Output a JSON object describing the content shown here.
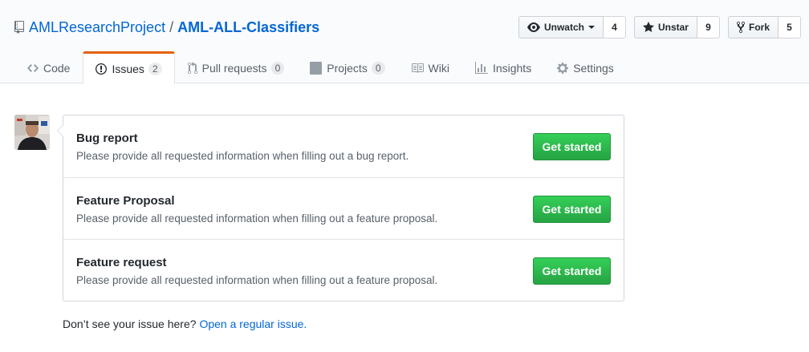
{
  "repo": {
    "owner": "AMLResearchProject",
    "separator": "/",
    "name": "AML-ALL-Classifiers"
  },
  "actions": {
    "watch": {
      "label": "Unwatch",
      "count": "4"
    },
    "star": {
      "label": "Unstar",
      "count": "9"
    },
    "fork": {
      "label": "Fork",
      "count": "5"
    }
  },
  "tabs": [
    {
      "label": "Code",
      "icon": "code-icon"
    },
    {
      "label": "Issues",
      "icon": "issue-icon",
      "counter": "2",
      "selected": true
    },
    {
      "label": "Pull requests",
      "icon": "pull-request-icon",
      "counter": "0"
    },
    {
      "label": "Projects",
      "icon": "project-icon",
      "counter": "0"
    },
    {
      "label": "Wiki",
      "icon": "book-icon"
    },
    {
      "label": "Insights",
      "icon": "graph-icon"
    },
    {
      "label": "Settings",
      "icon": "gear-icon"
    }
  ],
  "templates": [
    {
      "title": "Bug report",
      "description": "Please provide all requested information when filling out a bug report.",
      "button": "Get started"
    },
    {
      "title": "Feature Proposal",
      "description": "Please provide all requested information when filling out a feature proposal.",
      "button": "Get started"
    },
    {
      "title": "Feature request",
      "description": "Please provide all requested information when filling out a feature proposal.",
      "button": "Get started"
    }
  ],
  "footer": {
    "text": "Don’t see your issue here?",
    "link": "Open a regular issue."
  },
  "colors": {
    "link": "#0366d6",
    "selected_tab_accent": "#e36209",
    "primary_button": "#28a745"
  }
}
